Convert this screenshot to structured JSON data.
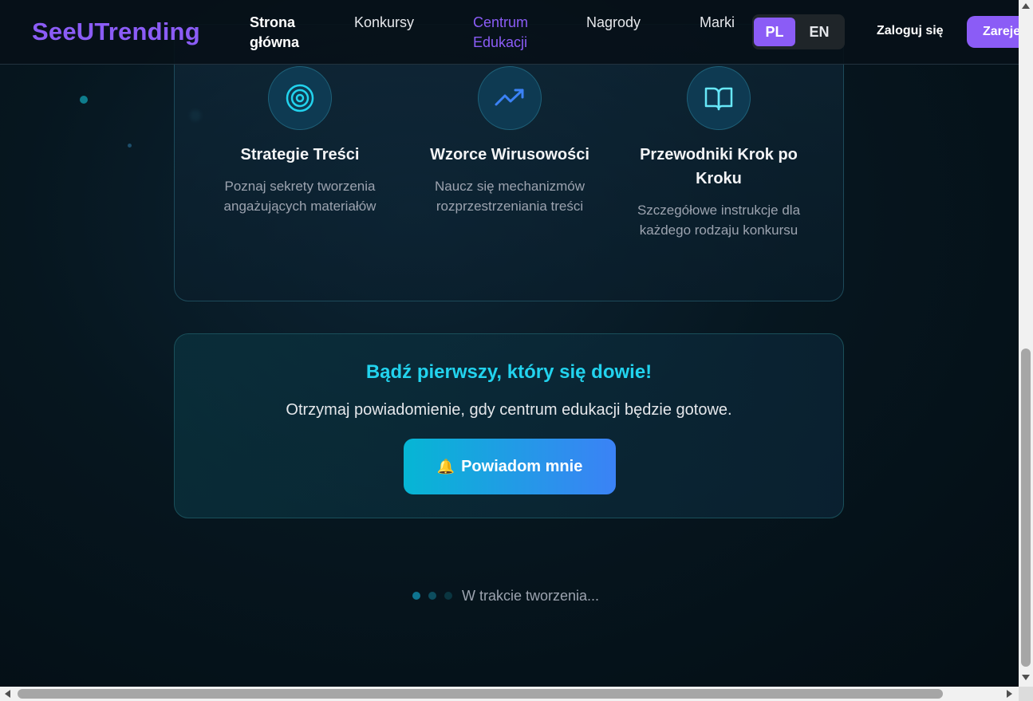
{
  "header": {
    "logo": "SeeUTrending",
    "nav": [
      {
        "label": "Strona główna"
      },
      {
        "label": "Konkursy"
      },
      {
        "label": "Centrum Edukacji"
      },
      {
        "label": "Nagrody"
      },
      {
        "label": "Marki"
      }
    ],
    "lang": {
      "pl": "PL",
      "en": "EN",
      "selected": "PL"
    },
    "login_label": "Zaloguj się",
    "register_label": "Zarejestruj się"
  },
  "features": [
    {
      "icon": "target-icon",
      "title": "Strategie Treści",
      "desc": "Poznaj sekrety tworzenia angażujących materiałów"
    },
    {
      "icon": "trending-up-icon",
      "title": "Wzorce Wirusowości",
      "desc": "Naucz się mechanizmów rozprzestrzeniania treści"
    },
    {
      "icon": "book-open-icon",
      "title": "Przewodniki Krok po Kroku",
      "desc": "Szczegółowe instrukcje dla każdego rodzaju konkursu"
    }
  ],
  "cta": {
    "title": "Bądź pierwszy, który się dowie!",
    "text": "Otrzymaj powiadomienie, gdy centrum edukacji będzie gotowe.",
    "button_icon": "🔔",
    "button_label": "Powiadom mnie"
  },
  "status": {
    "text": "W trakcie tworzenia..."
  },
  "colors": {
    "accent": "#8b5cf6",
    "cyan": "#22d3ee",
    "background": "#06161f"
  }
}
